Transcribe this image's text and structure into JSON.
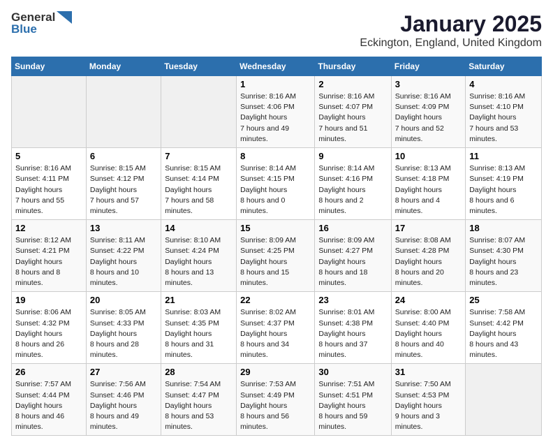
{
  "header": {
    "logo_general": "General",
    "logo_blue": "Blue",
    "title": "January 2025",
    "subtitle": "Eckington, England, United Kingdom"
  },
  "weekdays": [
    "Sunday",
    "Monday",
    "Tuesday",
    "Wednesday",
    "Thursday",
    "Friday",
    "Saturday"
  ],
  "weeks": [
    [
      {
        "day": "",
        "empty": true
      },
      {
        "day": "",
        "empty": true
      },
      {
        "day": "",
        "empty": true
      },
      {
        "day": "1",
        "sunrise": "8:16 AM",
        "sunset": "4:06 PM",
        "daylight": "7 hours and 49 minutes."
      },
      {
        "day": "2",
        "sunrise": "8:16 AM",
        "sunset": "4:07 PM",
        "daylight": "7 hours and 51 minutes."
      },
      {
        "day": "3",
        "sunrise": "8:16 AM",
        "sunset": "4:09 PM",
        "daylight": "7 hours and 52 minutes."
      },
      {
        "day": "4",
        "sunrise": "8:16 AM",
        "sunset": "4:10 PM",
        "daylight": "7 hours and 53 minutes."
      }
    ],
    [
      {
        "day": "5",
        "sunrise": "8:16 AM",
        "sunset": "4:11 PM",
        "daylight": "7 hours and 55 minutes."
      },
      {
        "day": "6",
        "sunrise": "8:15 AM",
        "sunset": "4:12 PM",
        "daylight": "7 hours and 57 minutes."
      },
      {
        "day": "7",
        "sunrise": "8:15 AM",
        "sunset": "4:14 PM",
        "daylight": "7 hours and 58 minutes."
      },
      {
        "day": "8",
        "sunrise": "8:14 AM",
        "sunset": "4:15 PM",
        "daylight": "8 hours and 0 minutes."
      },
      {
        "day": "9",
        "sunrise": "8:14 AM",
        "sunset": "4:16 PM",
        "daylight": "8 hours and 2 minutes."
      },
      {
        "day": "10",
        "sunrise": "8:13 AM",
        "sunset": "4:18 PM",
        "daylight": "8 hours and 4 minutes."
      },
      {
        "day": "11",
        "sunrise": "8:13 AM",
        "sunset": "4:19 PM",
        "daylight": "8 hours and 6 minutes."
      }
    ],
    [
      {
        "day": "12",
        "sunrise": "8:12 AM",
        "sunset": "4:21 PM",
        "daylight": "8 hours and 8 minutes."
      },
      {
        "day": "13",
        "sunrise": "8:11 AM",
        "sunset": "4:22 PM",
        "daylight": "8 hours and 10 minutes."
      },
      {
        "day": "14",
        "sunrise": "8:10 AM",
        "sunset": "4:24 PM",
        "daylight": "8 hours and 13 minutes."
      },
      {
        "day": "15",
        "sunrise": "8:09 AM",
        "sunset": "4:25 PM",
        "daylight": "8 hours and 15 minutes."
      },
      {
        "day": "16",
        "sunrise": "8:09 AM",
        "sunset": "4:27 PM",
        "daylight": "8 hours and 18 minutes."
      },
      {
        "day": "17",
        "sunrise": "8:08 AM",
        "sunset": "4:28 PM",
        "daylight": "8 hours and 20 minutes."
      },
      {
        "day": "18",
        "sunrise": "8:07 AM",
        "sunset": "4:30 PM",
        "daylight": "8 hours and 23 minutes."
      }
    ],
    [
      {
        "day": "19",
        "sunrise": "8:06 AM",
        "sunset": "4:32 PM",
        "daylight": "8 hours and 26 minutes."
      },
      {
        "day": "20",
        "sunrise": "8:05 AM",
        "sunset": "4:33 PM",
        "daylight": "8 hours and 28 minutes."
      },
      {
        "day": "21",
        "sunrise": "8:03 AM",
        "sunset": "4:35 PM",
        "daylight": "8 hours and 31 minutes."
      },
      {
        "day": "22",
        "sunrise": "8:02 AM",
        "sunset": "4:37 PM",
        "daylight": "8 hours and 34 minutes."
      },
      {
        "day": "23",
        "sunrise": "8:01 AM",
        "sunset": "4:38 PM",
        "daylight": "8 hours and 37 minutes."
      },
      {
        "day": "24",
        "sunrise": "8:00 AM",
        "sunset": "4:40 PM",
        "daylight": "8 hours and 40 minutes."
      },
      {
        "day": "25",
        "sunrise": "7:58 AM",
        "sunset": "4:42 PM",
        "daylight": "8 hours and 43 minutes."
      }
    ],
    [
      {
        "day": "26",
        "sunrise": "7:57 AM",
        "sunset": "4:44 PM",
        "daylight": "8 hours and 46 minutes."
      },
      {
        "day": "27",
        "sunrise": "7:56 AM",
        "sunset": "4:46 PM",
        "daylight": "8 hours and 49 minutes."
      },
      {
        "day": "28",
        "sunrise": "7:54 AM",
        "sunset": "4:47 PM",
        "daylight": "8 hours and 53 minutes."
      },
      {
        "day": "29",
        "sunrise": "7:53 AM",
        "sunset": "4:49 PM",
        "daylight": "8 hours and 56 minutes."
      },
      {
        "day": "30",
        "sunrise": "7:51 AM",
        "sunset": "4:51 PM",
        "daylight": "8 hours and 59 minutes."
      },
      {
        "day": "31",
        "sunrise": "7:50 AM",
        "sunset": "4:53 PM",
        "daylight": "9 hours and 3 minutes."
      },
      {
        "day": "",
        "empty": true
      }
    ]
  ]
}
